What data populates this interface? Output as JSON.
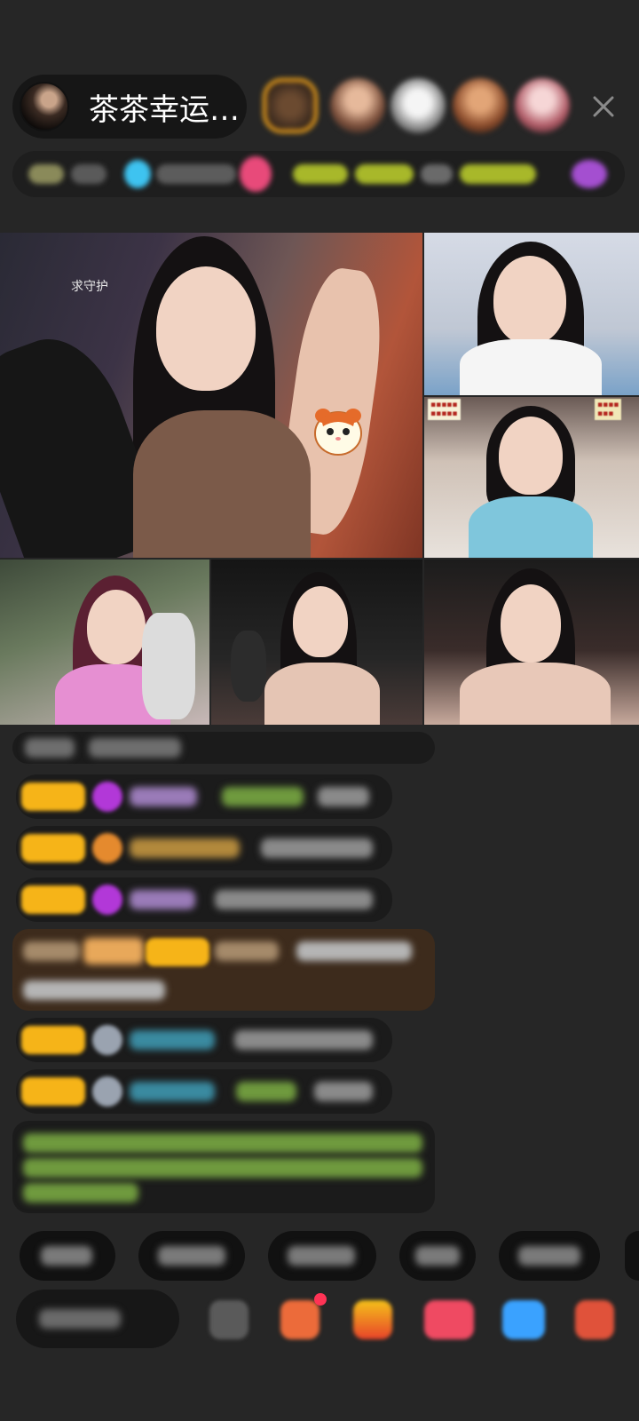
{
  "header": {
    "host_name": "茶茶幸运…",
    "close_icon": "close-icon"
  },
  "video_grid": {
    "main_tile_caption": "求守护"
  },
  "colors": {
    "background": "#262626",
    "badge": "#f6b418",
    "accent_pink": "#e84a7a",
    "accent_green": "#9acd32"
  }
}
